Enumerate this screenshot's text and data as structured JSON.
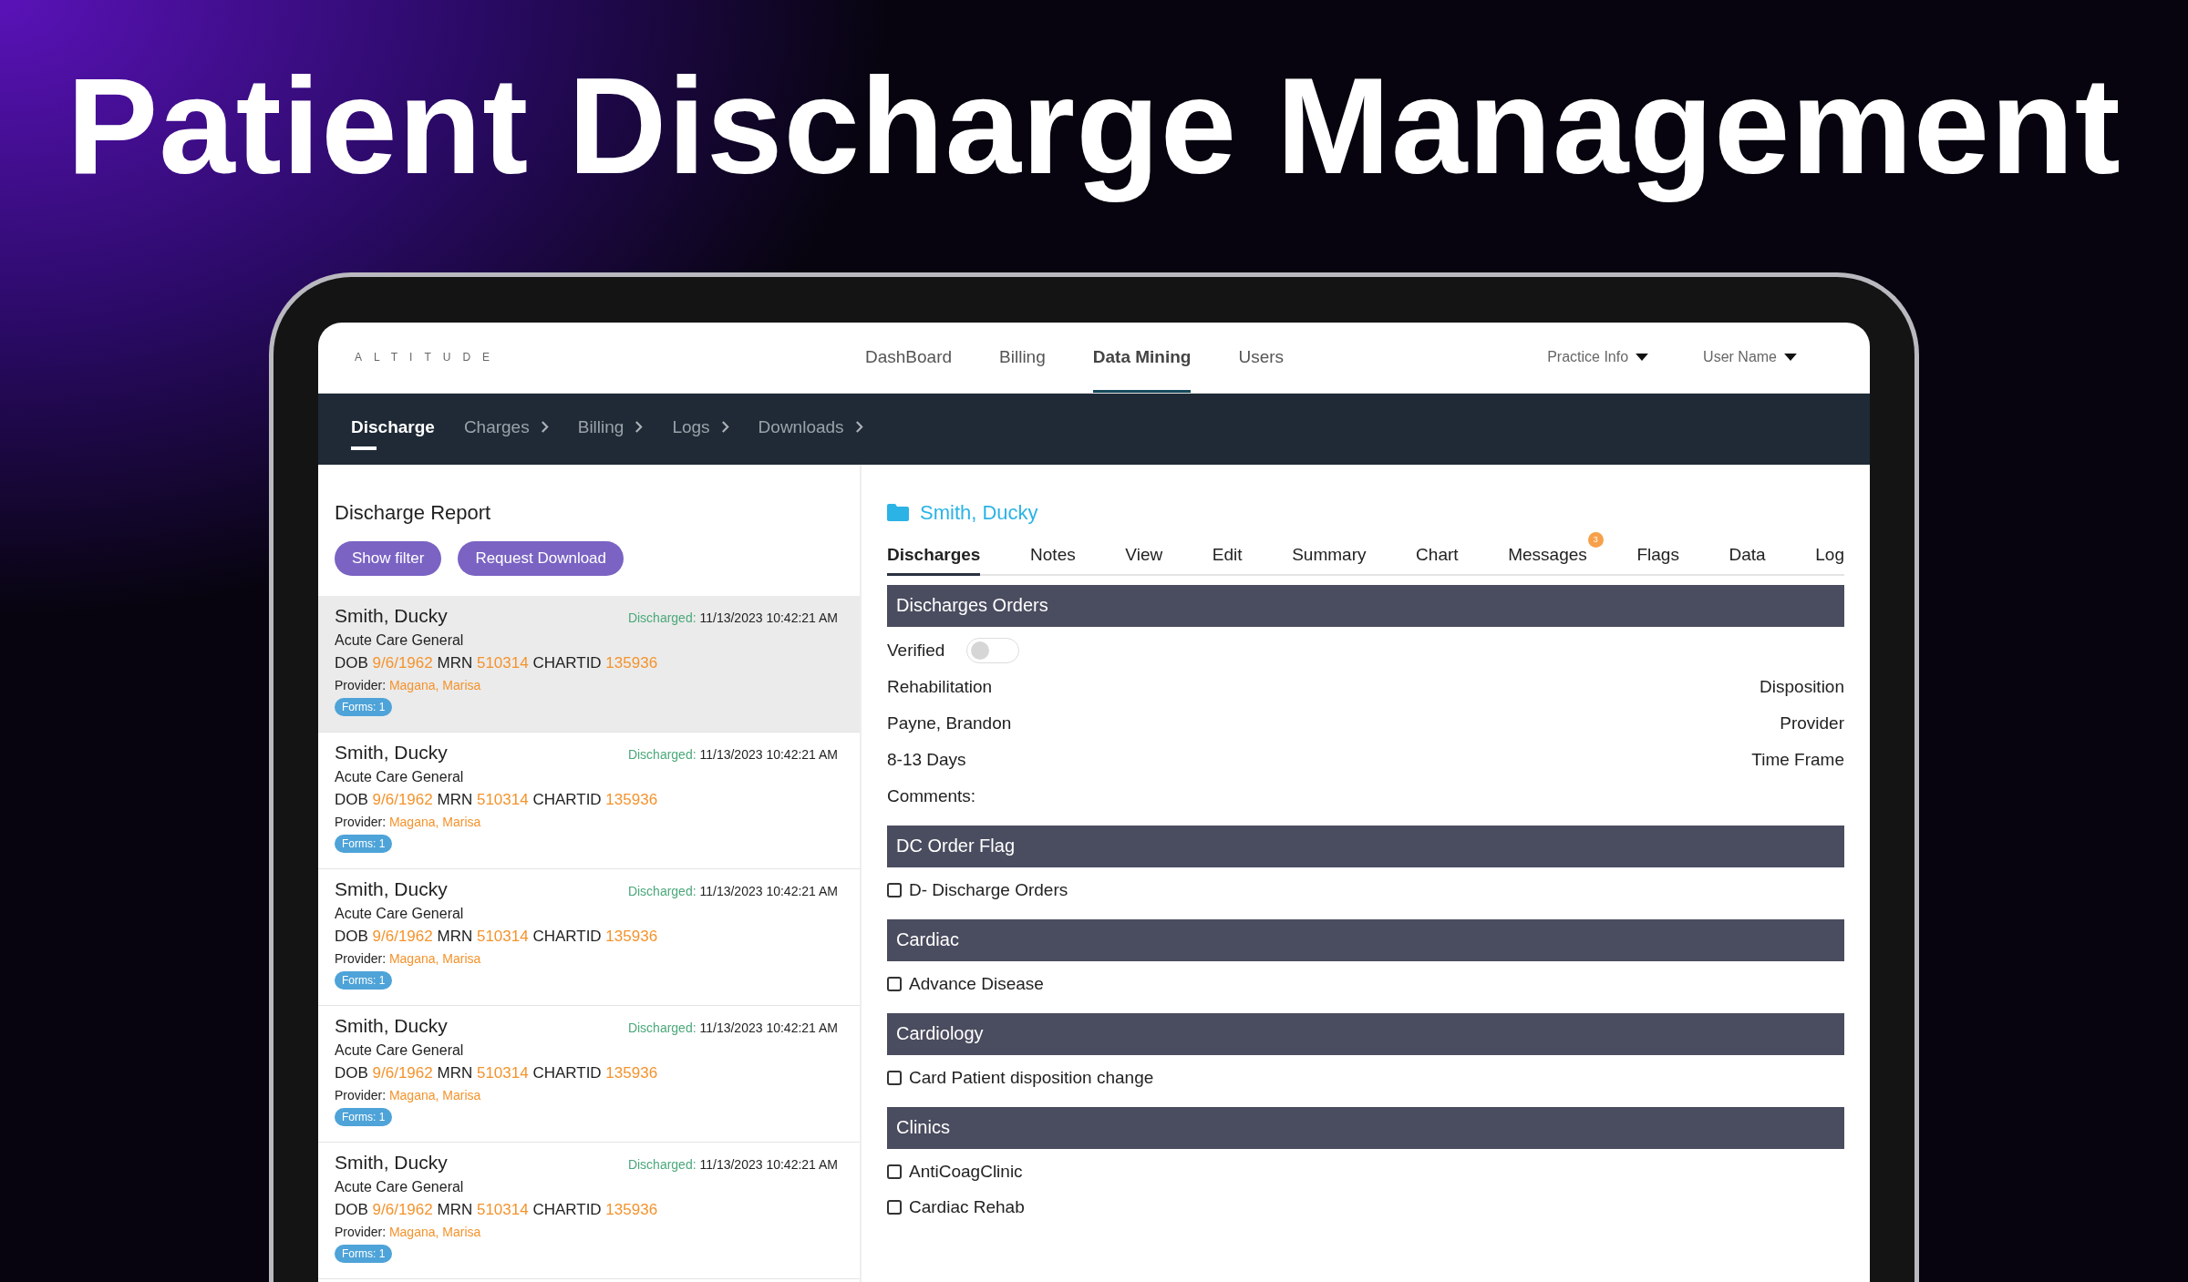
{
  "headline": "Patient Discharge Management",
  "app": {
    "logo": "ALTITUDE",
    "nav": [
      {
        "label": "DashBoard",
        "selected": false
      },
      {
        "label": "Billing",
        "selected": false
      },
      {
        "label": "Data Mining",
        "selected": true
      },
      {
        "label": "Users",
        "selected": false
      }
    ],
    "menus": [
      "Practice Info",
      "User Name"
    ],
    "subnav": [
      {
        "label": "Discharge",
        "selected": true
      },
      {
        "label": "Charges",
        "selected": false
      },
      {
        "label": "Billing",
        "selected": false
      },
      {
        "label": "Logs",
        "selected": false
      },
      {
        "label": "Downloads",
        "selected": false
      }
    ]
  },
  "report": {
    "title": "Discharge Report",
    "buttons": [
      "Show filter",
      "Request Download"
    ],
    "patients": [
      {
        "selected": true,
        "name": "Smith, Ducky",
        "discharged_label": "Discharged:",
        "discharged_at": "11/13/2023 10:42:21 AM",
        "facility": "Acute Care General",
        "dob_label": "DOB",
        "dob": "9/6/1962",
        "mrn_label": "MRN",
        "mrn": "510314",
        "chartid_label": "CHARTID",
        "chartid": "135936",
        "provider_label": "Provider:",
        "provider": "Magana, Marisa",
        "forms": "Forms: 1"
      },
      {
        "selected": false,
        "name": "Smith, Ducky",
        "discharged_label": "Discharged:",
        "discharged_at": "11/13/2023 10:42:21 AM",
        "facility": "Acute Care General",
        "dob_label": "DOB",
        "dob": "9/6/1962",
        "mrn_label": "MRN",
        "mrn": "510314",
        "chartid_label": "CHARTID",
        "chartid": "135936",
        "provider_label": "Provider:",
        "provider": "Magana, Marisa",
        "forms": "Forms: 1"
      },
      {
        "selected": false,
        "name": "Smith, Ducky",
        "discharged_label": "Discharged:",
        "discharged_at": "11/13/2023 10:42:21 AM",
        "facility": "Acute Care General",
        "dob_label": "DOB",
        "dob": "9/6/1962",
        "mrn_label": "MRN",
        "mrn": "510314",
        "chartid_label": "CHARTID",
        "chartid": "135936",
        "provider_label": "Provider:",
        "provider": "Magana, Marisa",
        "forms": "Forms: 1"
      },
      {
        "selected": false,
        "name": "Smith, Ducky",
        "discharged_label": "Discharged:",
        "discharged_at": "11/13/2023 10:42:21 AM",
        "facility": "Acute Care General",
        "dob_label": "DOB",
        "dob": "9/6/1962",
        "mrn_label": "MRN",
        "mrn": "510314",
        "chartid_label": "CHARTID",
        "chartid": "135936",
        "provider_label": "Provider:",
        "provider": "Magana, Marisa",
        "forms": "Forms: 1"
      },
      {
        "selected": false,
        "name": "Smith, Ducky",
        "discharged_label": "Discharged:",
        "discharged_at": "11/13/2023 10:42:21 AM",
        "facility": "Acute Care General",
        "dob_label": "DOB",
        "dob": "9/6/1962",
        "mrn_label": "MRN",
        "mrn": "510314",
        "chartid_label": "CHARTID",
        "chartid": "135936",
        "provider_label": "Provider:",
        "provider": "Magana, Marisa",
        "forms": "Forms: 1"
      }
    ]
  },
  "detail": {
    "patient": "Smith, Ducky",
    "tabs": [
      {
        "label": "Discharges",
        "selected": true
      },
      {
        "label": "Notes",
        "selected": false
      },
      {
        "label": "View",
        "selected": false
      },
      {
        "label": "Edit",
        "selected": false
      },
      {
        "label": "Summary",
        "selected": false
      },
      {
        "label": "Chart",
        "selected": false
      },
      {
        "label": "Messages",
        "selected": false,
        "badge": "3"
      },
      {
        "label": "Flags",
        "selected": false
      },
      {
        "label": "Data",
        "selected": false
      },
      {
        "label": "Log",
        "selected": false
      }
    ],
    "sections": [
      {
        "title": "Discharges Orders",
        "rows": [
          {
            "kind": "toggle",
            "label": "Verified",
            "on": false
          },
          {
            "kind": "pair",
            "answer": "Rehabilitation",
            "field_name": "Disposition"
          },
          {
            "kind": "pair",
            "answer": "Payne, Brandon",
            "field_name": "Provider"
          },
          {
            "kind": "pair",
            "answer": "8-13 Days",
            "field_name": "Time Frame"
          },
          {
            "kind": "text",
            "label": "Comments:"
          }
        ]
      },
      {
        "title": "DC Order Flag",
        "rows": [
          {
            "kind": "checkbox",
            "label": "D- Discharge Orders",
            "checked": false
          }
        ]
      },
      {
        "title": "Cardiac",
        "rows": [
          {
            "kind": "checkbox",
            "label": "Advance Disease",
            "checked": false
          }
        ]
      },
      {
        "title": "Cardiology",
        "rows": [
          {
            "kind": "checkbox",
            "label": "Card Patient disposition change",
            "checked": false
          }
        ]
      },
      {
        "title": "Clinics",
        "rows": [
          {
            "kind": "checkbox",
            "label": "AntiCoagClinic",
            "checked": false
          },
          {
            "kind": "checkbox",
            "label": "Cardiac Rehab",
            "checked": false
          }
        ]
      }
    ]
  }
}
